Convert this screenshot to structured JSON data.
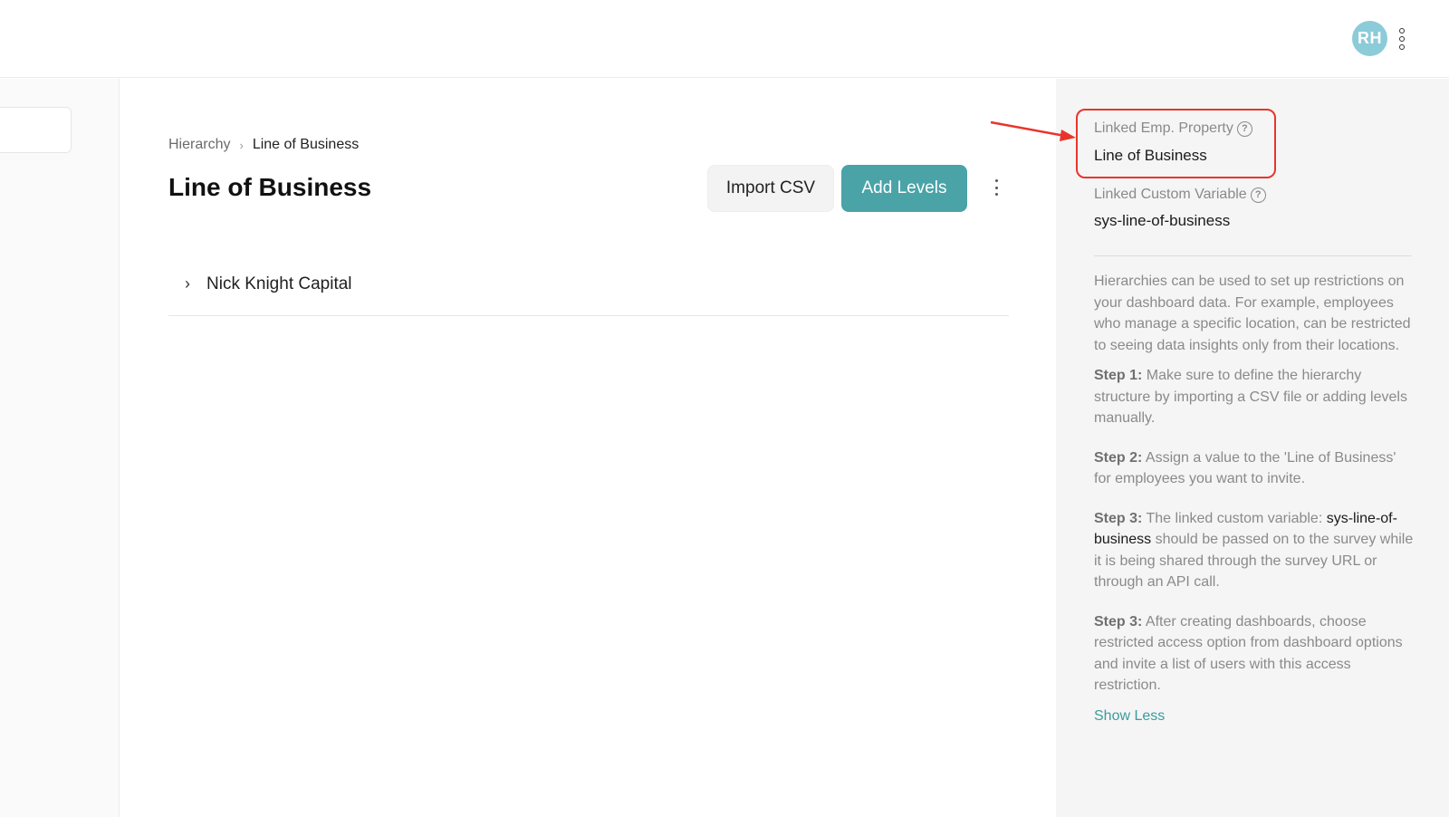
{
  "topbar": {
    "avatar_initials": "RH",
    "avatar_color": "#8ccbd8",
    "menu_icon": "vertical-dots-icon"
  },
  "main": {
    "breadcrumb": {
      "root": "Hierarchy",
      "separator": "›",
      "current": "Line of Business"
    },
    "title": "Line of Business",
    "buttons": {
      "import_label": "Import CSV",
      "add_label": "Add Levels"
    },
    "accent_color": "#4aa3a7",
    "tree": [
      {
        "label": "Nick Knight Capital",
        "expanded": false
      }
    ]
  },
  "sidepanel": {
    "linked_emp_property": {
      "label": "Linked Emp. Property",
      "value": "Line of Business"
    },
    "linked_custom_variable": {
      "label": "Linked Custom Variable",
      "value": "sys-line-of-business"
    },
    "intro": "Hierarchies can be used to set up restrictions on your dashboard data. For example, employees who manage a specific location, can be restricted to seeing data insights only from their locations.",
    "steps": [
      {
        "label": "Step 1:",
        "text": " Make sure to define the hierarchy structure by importing a CSV file or adding levels manually."
      },
      {
        "label": "Step 2:",
        "text": " Assign a value to the 'Line of Business' for employees you want to invite."
      },
      {
        "label": "Step 3:",
        "text_before": " The linked custom variable: ",
        "variable": "sys-line-of-business",
        "text_after": " should be passed on to the survey while it is being shared through the survey URL or through an API call."
      },
      {
        "label": "Step 3:",
        "text": " After creating dashboards, choose restricted access option from dashboard options and invite a list of users with this access restriction."
      }
    ],
    "show_less": "Show Less",
    "annotation_color": "#e8352b"
  }
}
